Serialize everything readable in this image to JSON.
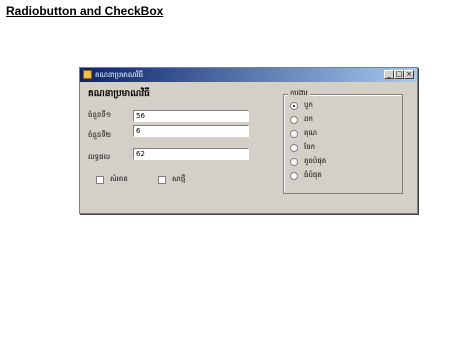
{
  "slide": {
    "title": "Radiobutton and CheckBox"
  },
  "window": {
    "title": "គណនាប្រមាណវិធី",
    "minimize_glyph": "_",
    "maximize_glyph": "□",
    "close_glyph": "×"
  },
  "form": {
    "heading": "គណនាប្រមាណវិធី",
    "fields": [
      {
        "label": "ចំនួនទី១",
        "value": "56"
      },
      {
        "label": "ចំនួនទី២",
        "value": "6"
      },
      {
        "label": "លទ្ធផល",
        "value": "62"
      }
    ],
    "checkboxes": [
      {
        "label": "សំអាត",
        "checked": false
      },
      {
        "label": "សាថ្មី",
        "checked": false
      }
    ]
  },
  "operations": {
    "title": "ការងារ",
    "options": [
      {
        "label": "បូក",
        "checked": true
      },
      {
        "label": "ដក",
        "checked": false
      },
      {
        "label": "គុណ",
        "checked": false
      },
      {
        "label": "ចែក",
        "checked": false
      },
      {
        "label": "តូចបំផុត",
        "checked": false
      },
      {
        "label": "ធំបំផុត",
        "checked": false
      }
    ]
  }
}
